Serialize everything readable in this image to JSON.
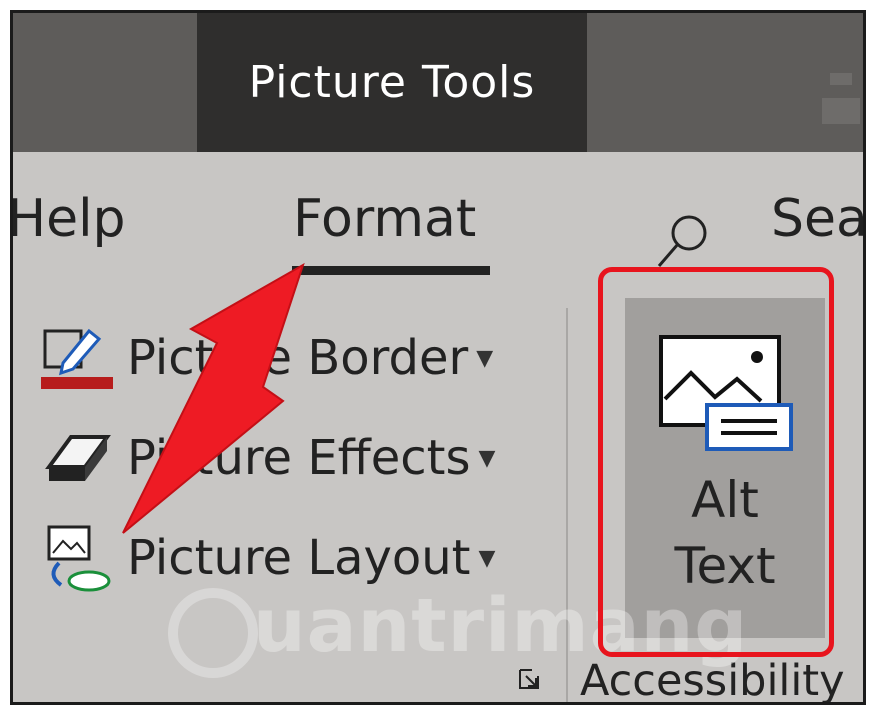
{
  "title_bar": {
    "contextual_tab_label": "Picture Tools"
  },
  "tabs": [
    {
      "label": "Help"
    },
    {
      "label": "Format",
      "selected": true
    }
  ],
  "search": {
    "label": "Sear",
    "icon": "search-icon"
  },
  "commands": [
    {
      "label": "Picture Border",
      "icon": "pen-border-icon",
      "accent": "#b71c1c"
    },
    {
      "label": "Picture Effects",
      "icon": "eraser-effects-icon"
    },
    {
      "label": "Picture Layout",
      "icon": "layout-smartart-icon"
    }
  ],
  "alt_text": {
    "line1": "Alt",
    "line2": "Text",
    "icon": "alt-text-image-icon"
  },
  "group": {
    "label": "Accessibility"
  },
  "annotations": {
    "highlight_color": "#e8141d",
    "arrow_color": "#ee1b24"
  },
  "watermark": {
    "text": "uantrimang"
  }
}
